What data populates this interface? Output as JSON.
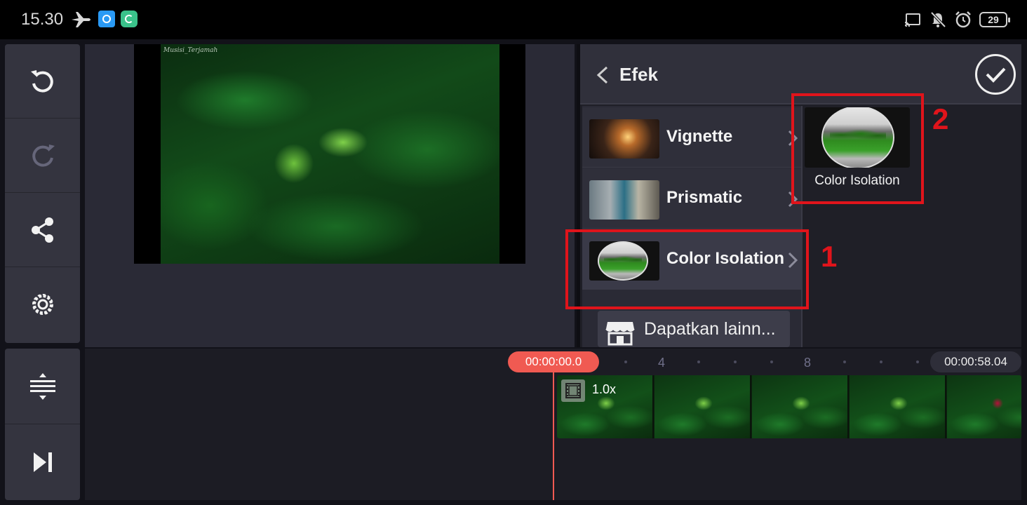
{
  "status_bar": {
    "time": "15.30",
    "battery": "29",
    "icons": [
      "airplane-mode-icon",
      "app-notification-icon",
      "sync-app-icon",
      "cast-icon",
      "notifications-off-icon",
      "alarm-icon",
      "battery-icon"
    ]
  },
  "toolbar_left": {
    "top": [
      "undo-icon",
      "redo-icon",
      "share-icon",
      "settings-icon"
    ],
    "bottom": [
      "timeline-expand-icon",
      "skip-to-end-icon"
    ]
  },
  "preview": {
    "watermark": "Musisi_Terjamah"
  },
  "effect_panel": {
    "title": "Efek",
    "items": [
      {
        "label": "Vignette"
      },
      {
        "label": "Prismatic"
      },
      {
        "label": "Color Isolation",
        "selected": true
      }
    ],
    "store_label": "Dapatkan lainn...",
    "sub_effect": {
      "label": "Color Isolation"
    }
  },
  "annotations": {
    "one": "1",
    "two": "2",
    "color": "#e0141b"
  },
  "timeline": {
    "current_time": "00:00:00.0",
    "end_time": "00:00:58.04",
    "ruler_labels": [
      "4",
      "8"
    ],
    "clip_speed": "1.0x"
  },
  "colors": {
    "accent_playhead": "#f05a52",
    "panel_bg": "#1f1f27",
    "toolbar_bg": "#34343f"
  }
}
